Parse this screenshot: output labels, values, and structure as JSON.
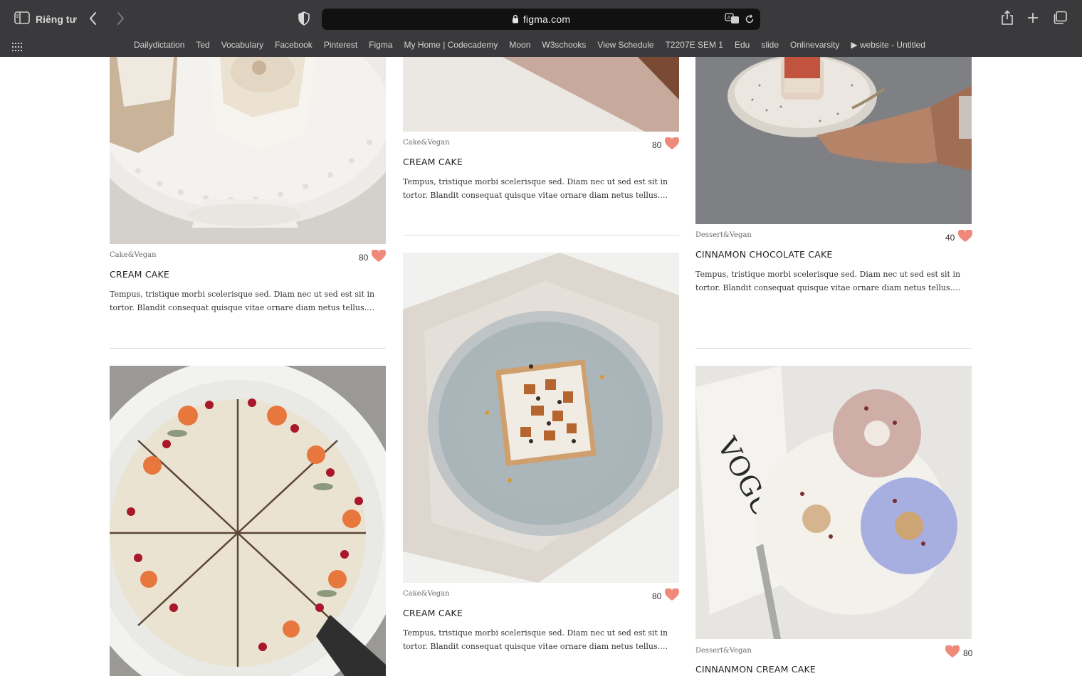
{
  "browser": {
    "sidebar_label": "Riêng tư",
    "url": "figma.com",
    "bookmarks": [
      "Dailydictation",
      "Ted",
      "Vocabulary",
      "Facebook",
      "Pinterest",
      "Figma",
      "My Home | Codecademy",
      "Moon",
      "W3schooks",
      "View Schedule",
      "T2207E SEM 1",
      "Edu",
      "slide",
      "Onlinevarsity",
      "▶ website - Untitled"
    ]
  },
  "colors": {
    "heart": "#ef8a7b",
    "chrome": "#3a3a3c",
    "url_bg": "#111111"
  },
  "cards": [
    {
      "category": "Cake&Vegan",
      "likes": "80",
      "title": "CREAM CAKE",
      "description": "Tempus, tristique morbi scelerisque sed. Diam nec ut sed est sit in tortor. Blandit consequat quisque vitae ornare diam netus tellus. Tempus, tristique morbi scelerisque sed."
    },
    {
      "category": "Cake&Vegan",
      "likes": "80",
      "title": "CREAM CAKE",
      "description": "Tempus, tristique morbi scelerisque sed. Diam nec ut sed est sit in tortor. Blandit consequat quisque vitae ornare diam netus tellus. Tempus, tristique morbi scelerisque sed."
    },
    {
      "category": "Dessert&Vegan",
      "likes": "40",
      "title": "CINNAMON CHOCOLATE CAKE",
      "description": "Tempus, tristique morbi scelerisque sed. Diam nec ut sed est sit in tortor. Blandit consequat quisque vitae ornare diam netus tellus. Tempus, tristique morbi scelerisque sed."
    },
    {
      "category": "Cake&Vegan",
      "likes": "80",
      "title": "CREAM CAKE",
      "description": "Tempus, tristique morbi scelerisque sed. Diam nec ut sed est sit in tortor. Blandit consequat quisque vitae ornare diam netus tellus. Tempus, tristique morbi scelerisque sed."
    },
    {
      "category": "Dessert&Vegan",
      "likes": "80",
      "title": "CINNANMON CREAM CAKE",
      "description": ""
    }
  ]
}
